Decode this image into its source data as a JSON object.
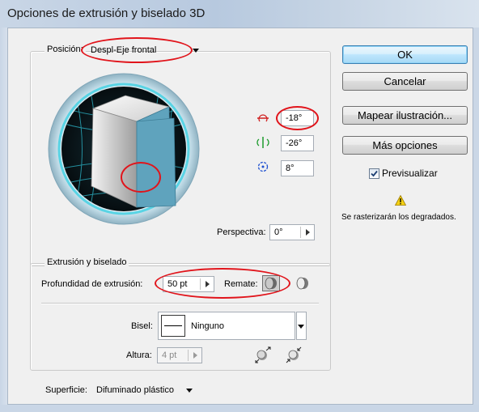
{
  "window": {
    "title": "Opciones de extrusión y biselado 3D"
  },
  "position": {
    "label": "Posición:",
    "selected": "Despl-Eje frontal",
    "rotation_x": "-18°",
    "rotation_y": "-26°",
    "rotation_z": "8°",
    "perspective_label": "Perspectiva:",
    "perspective_value": "0°"
  },
  "buttons": {
    "ok": "OK",
    "cancel": "Cancelar",
    "map": "Mapear ilustración...",
    "more": "Más opciones"
  },
  "preview": {
    "label": "Previsualizar",
    "checked": true
  },
  "warning": {
    "text": "Se rasterizarán los degradados."
  },
  "extrusion": {
    "legend": "Extrusión y biselado",
    "depth_label": "Profundidad de extrusión:",
    "depth_value": "50 pt",
    "cap_label": "Remate:",
    "bevel_label": "Bisel:",
    "bevel_value": "Ninguno",
    "height_label": "Altura:",
    "height_value": "4 pt"
  },
  "surface": {
    "label": "Superficie:",
    "value": "Difuminado plástico"
  },
  "icons": {
    "rotate_x": "rotate-x-axis-icon",
    "rotate_y": "rotate-y-axis-icon",
    "rotate_z": "rotate-z-axis-icon",
    "cap_on": "cap-on-icon",
    "cap_off": "cap-off-icon",
    "bevel_out": "bevel-extent-out-icon",
    "bevel_in": "bevel-extent-in-icon",
    "warning": "warning-icon"
  },
  "colors": {
    "annotation": "#e1141b",
    "cube_front": "#5fa3bd",
    "track_glow": "#39c4d6"
  }
}
